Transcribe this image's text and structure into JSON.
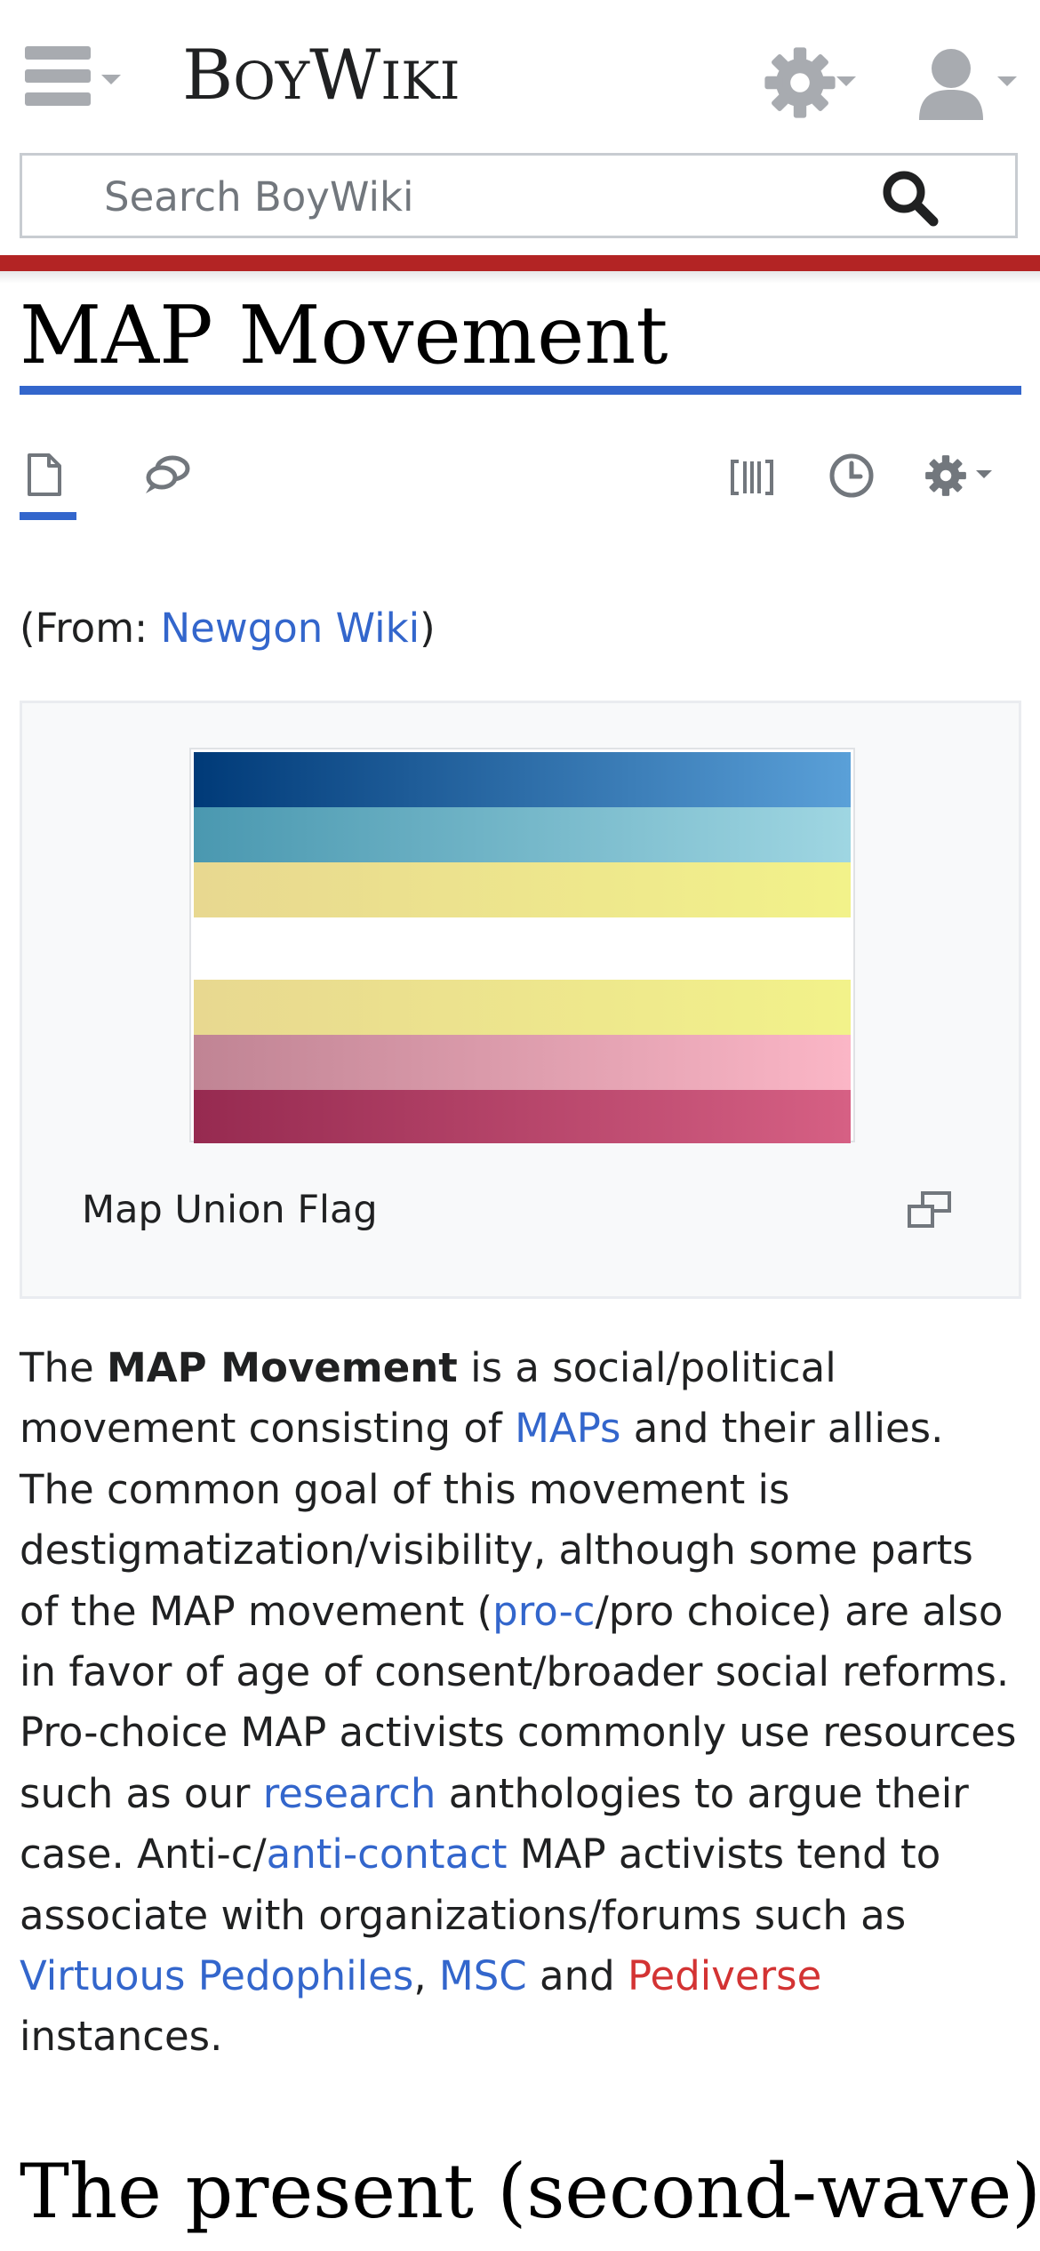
{
  "header": {
    "brand_initial_1": "B",
    "brand_rest_1": "OY",
    "brand_initial_2": "W",
    "brand_rest_2": "IKI",
    "menu_icon": "hamburger-menu-icon",
    "settings_icon": "gear-icon",
    "user_icon": "user-icon"
  },
  "search": {
    "placeholder": "Search BoyWiki",
    "icon": "magnifier-icon"
  },
  "page": {
    "title": "MAP Movement"
  },
  "page_actions": {
    "tabs": [
      "page-icon",
      "talk-icon"
    ],
    "right_actions": [
      "language-brackets-icon",
      "history-icon",
      "gear-icon"
    ]
  },
  "content": {
    "from_prefix": "(From: ",
    "from_link": "Newgon Wiki",
    "from_suffix": ")",
    "figure": {
      "caption": "Map Union Flag",
      "enlarge_icon": "magnify-clip-icon"
    },
    "paragraph": {
      "t1": "The ",
      "bold": "MAP Movement",
      "t2": " is a social/political movement consisting of ",
      "link_maps": "MAPs",
      "t3": " and their allies. The common goal of this movement is destigmatization/visibility, although some parts of the MAP movement (",
      "link_proc": "pro-c",
      "t4": "/pro choice) are also in favor of age of consent/broader social reforms. Pro-choice MAP activists commonly use resources such as our ",
      "link_research": "research",
      "t5": " anthologies to argue their case. Anti-c/",
      "link_anticontact": "anti-contact",
      "t6": " MAP activists tend to associate with organizations/forums such as ",
      "link_vp": "Virtuous Pedophiles",
      "t7": ", ",
      "link_msc": "MSC",
      "t8": " and ",
      "link_pediverse": "Pediverse",
      "t9": " instances."
    },
    "section_heading": "The present (second-wave)"
  },
  "colors": {
    "link": "#3366cc",
    "redlink": "#d33333",
    "brand_bar": "#b32424",
    "icon_gray": "#a8abb0",
    "flag_stripes": [
      [
        "#003a78",
        "#5aa0d8"
      ],
      [
        "#4a98b0",
        "#9fd6e2"
      ],
      [
        "#e8d890",
        "#f2f28a"
      ],
      [
        "#ffffff",
        "#ffffff"
      ],
      [
        "#e8d890",
        "#f2f28a"
      ],
      [
        "#c08494",
        "#fbb6c6"
      ],
      [
        "#962a50",
        "#d66084"
      ]
    ]
  }
}
